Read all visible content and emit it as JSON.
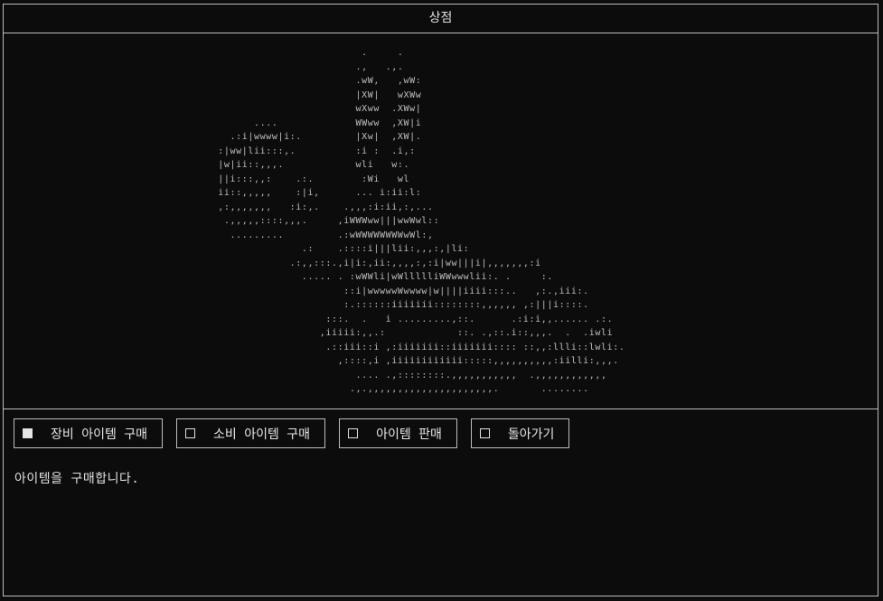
{
  "window": {
    "title": "상점"
  },
  "art": {
    "lines": [
      "                          .     .",
      "                         .,   .,.",
      "                         .wW,   ,wW:",
      "                         |XW|   wXWw",
      "                         wXww  .XWw|",
      "        ....             WWww  ,XW|i",
      "    .:i|wwww|i:.         |Xw|  ,XW|.",
      "  :|ww|lii:::,.          :i :  .i,:",
      "  |w|ii::,,,.            wli   w:.",
      "  ||i:::,,:    .:.        :Wi   wl",
      "  ii::,,,,,    :|i,      ... i:ii:l:",
      "  ,:,,,,,,,   :i:,.    .,,,:i:ii,:,...",
      "   .,,,,,::::,,,.     ,iWWWww|||wwWwl::",
      "    .........         .:wWWWWWWWWwWl:,",
      "                .:    .::::i|||lii:,,,:,|li:",
      "              .:,,:::.,i|i:,ii:,,,,:,:i|ww|||i|,,,,,,,:i",
      "                ..... . :wWWli|wWllllliWWwwwlii:. .     :.",
      "                       ::i|wwwwwWwwww|w||||iiii:::..   ,:.,iii:.",
      "                       :.::::::iiiiiii::::::::,,,,,, ,:|||i::::.",
      "                    :::.  .   i .........,::.      .:i:i,,...... .:.",
      "                   ,iiiii:,,.:            ::. .,::.i::,,,.  .  .iwli",
      "                    .::iii::i ,:iiiiiii::iiiiiii:::: ::,,:llli::lwli:.",
      "                      ,::::,i ,iiiiiiiiiiii:::::,,,,,,,,,,:iilli:,,,.",
      "                         .... .,::::::::.,,,,,,,,,,,  .,,,,,,,,,,,,",
      "                        .,.,,,,,,,,,,,,,,,,,,,,,.       ........"
    ]
  },
  "menu": {
    "items": [
      {
        "label": "장비 아이템 구매",
        "checked": true
      },
      {
        "label": "소비 아이템 구매",
        "checked": false
      },
      {
        "label": "아이템 판매",
        "checked": false
      },
      {
        "label": "돌아가기",
        "checked": false
      }
    ]
  },
  "status": {
    "message": "아이템을 구매합니다."
  }
}
